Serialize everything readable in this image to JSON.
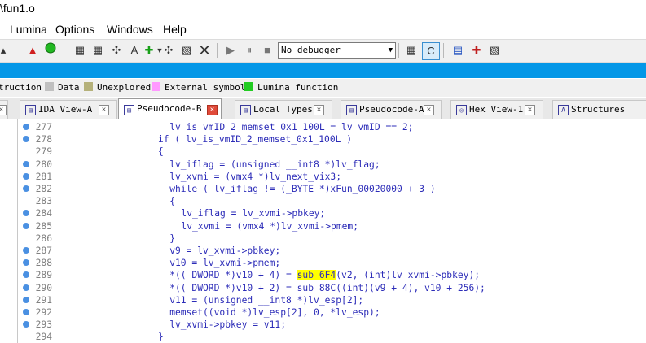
{
  "window": {
    "title": "\\fun1.o"
  },
  "menu": {
    "items": [
      "Lumina",
      "Options",
      "Windows",
      "Help"
    ]
  },
  "toolbar": {
    "debugger_select": "No debugger",
    "icons": [
      "bell-icon",
      "warning-icon",
      "green-circle-icon",
      "code-icon",
      "data-icon",
      "structure-icon",
      "add-icon",
      "remove-icon",
      "patch-icon",
      "close-icon",
      "play-icon",
      "pause-icon",
      "stop-icon",
      "debug-step-icon",
      "debug-run-icon",
      "trace-icon",
      "breakpoint-icon",
      "stop-trace-icon"
    ]
  },
  "legend": [
    {
      "label": "truction",
      "color": ""
    },
    {
      "label": "Data",
      "color": "#c0c0c0"
    },
    {
      "label": "Unexplored",
      "color": "#b5b17a"
    },
    {
      "label": "External symbol",
      "color": "#ff99ff"
    },
    {
      "label": "Lumina function",
      "color": "#22cc22"
    }
  ],
  "tabs": [
    {
      "label": "IDA View-A"
    },
    {
      "label": "Pseudocode-B"
    },
    {
      "label": "Local Types"
    },
    {
      "label": "Pseudocode-A"
    },
    {
      "label": "Hex View-1"
    },
    {
      "label": "Structures"
    }
  ],
  "code_lines": [
    {
      "num": "277",
      "text": "lv_is_vmID_2_memset_0x1_100L = lv_vmID == 2;",
      "indent": 3,
      "bp": true
    },
    {
      "num": "278",
      "text": "if ( lv_is_vmID_2_memset_0x1_100L )",
      "indent": 2,
      "bp": true
    },
    {
      "num": "279",
      "text": "{",
      "indent": 2,
      "bp": false
    },
    {
      "num": "280",
      "text": "lv_iflag = (unsigned __int8 *)lv_flag;",
      "indent": 3,
      "bp": true
    },
    {
      "num": "281",
      "text": "lv_xvmi = (vmx4 *)lv_next_vix3;",
      "indent": 3,
      "bp": true
    },
    {
      "num": "282",
      "text": "while ( lv_iflag != (_BYTE *)xFun_00020000 + 3 )",
      "indent": 3,
      "bp": true
    },
    {
      "num": "283",
      "text": "{",
      "indent": 3,
      "bp": false
    },
    {
      "num": "284",
      "text": "lv_iflag = lv_xvmi->pbkey;",
      "indent": 4,
      "bp": true
    },
    {
      "num": "285",
      "text": "lv_xvmi = (vmx4 *)lv_xvmi->pmem;",
      "indent": 4,
      "bp": true
    },
    {
      "num": "286",
      "text": "}",
      "indent": 3,
      "bp": false
    },
    {
      "num": "287",
      "text": "v9 = lv_xvmi->pbkey;",
      "indent": 3,
      "bp": true
    },
    {
      "num": "288",
      "text": "v10 = lv_xvmi->pmem;",
      "indent": 3,
      "bp": true
    },
    {
      "num": "289",
      "pre": "*((_DWORD *)v10 + 4) = ",
      "hl": "sub_6F4",
      "post": "(v2, (int)lv_xvmi->pbkey);",
      "indent": 3,
      "bp": true
    },
    {
      "num": "290",
      "text": "*((_DWORD *)v10 + 2) = sub_88C((int)(v9 + 4), v10 + 256);",
      "indent": 3,
      "bp": true
    },
    {
      "num": "291",
      "text": "v11 = (unsigned __int8 *)lv_esp[2];",
      "indent": 3,
      "bp": true
    },
    {
      "num": "292",
      "text": "memset((void *)lv_esp[2], 0, *lv_esp);",
      "indent": 3,
      "bp": true
    },
    {
      "num": "293",
      "text": "lv_xvmi->pbkey = v11;",
      "indent": 3,
      "bp": true
    },
    {
      "num": "294",
      "text": "}",
      "indent": 2,
      "bp": false
    }
  ]
}
